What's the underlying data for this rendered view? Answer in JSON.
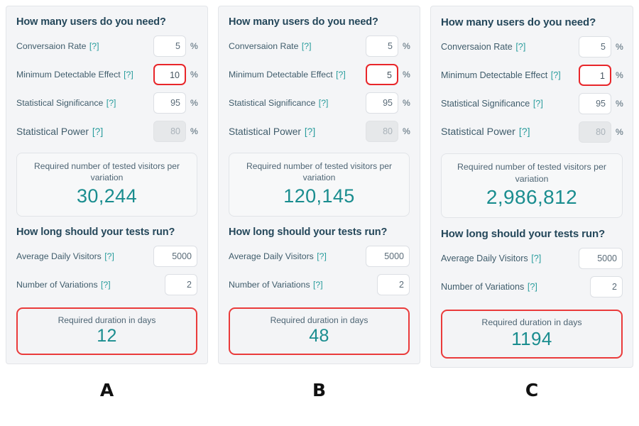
{
  "panels": [
    {
      "caption": "A",
      "users_heading": "How many users do you need?",
      "fields": [
        {
          "label": "Conversaion Rate",
          "help": "[?]",
          "value": "5",
          "unit": "%"
        },
        {
          "label": "Minimum Detectable Effect",
          "help": "[?]",
          "value": "10",
          "unit": "%"
        },
        {
          "label": "Statistical Significance",
          "help": "[?]",
          "value": "95",
          "unit": "%"
        },
        {
          "label": "Statistical Power",
          "help": "[?]",
          "value": "80",
          "unit": "%"
        }
      ],
      "visitors_caption": "Required number of tested visitors per variation",
      "visitors_value": "30,244",
      "duration_heading": "How long should your tests run?",
      "duration_fields": [
        {
          "label": "Average Daily Visitors",
          "help": "[?]",
          "value": "5000"
        },
        {
          "label": "Number of Variations",
          "help": "[?]",
          "value": "2"
        }
      ],
      "duration_caption": "Required duration in days",
      "duration_value": "12"
    },
    {
      "caption": "B",
      "users_heading": "How many users do you need?",
      "fields": [
        {
          "label": "Conversaion Rate",
          "help": "[?]",
          "value": "5",
          "unit": "%"
        },
        {
          "label": "Minimum Detectable Effect",
          "help": "[?]",
          "value": "5",
          "unit": "%"
        },
        {
          "label": "Statistical Significance",
          "help": "[?]",
          "value": "95",
          "unit": "%"
        },
        {
          "label": "Statistical Power",
          "help": "[?]",
          "value": "80",
          "unit": "%"
        }
      ],
      "visitors_caption": "Required number of tested visitors per variation",
      "visitors_value": "120,145",
      "duration_heading": "How long should your tests run?",
      "duration_fields": [
        {
          "label": "Average Daily Visitors",
          "help": "[?]",
          "value": "5000"
        },
        {
          "label": "Number of Variations",
          "help": "[?]",
          "value": "2"
        }
      ],
      "duration_caption": "Required duration in days",
      "duration_value": "48"
    },
    {
      "caption": "C",
      "users_heading": "How many users do you need?",
      "fields": [
        {
          "label": "Conversaion Rate",
          "help": "[?]",
          "value": "5",
          "unit": "%"
        },
        {
          "label": "Minimum Detectable Effect",
          "help": "[?]",
          "value": "1",
          "unit": "%"
        },
        {
          "label": "Statistical Significance",
          "help": "[?]",
          "value": "95",
          "unit": "%"
        },
        {
          "label": "Statistical Power",
          "help": "[?]",
          "value": "80",
          "unit": "%"
        }
      ],
      "visitors_caption": "Required number of tested visitors per variation",
      "visitors_value": "2,986,812",
      "duration_heading": "How long should your tests run?",
      "duration_fields": [
        {
          "label": "Average Daily Visitors",
          "help": "[?]",
          "value": "5000"
        },
        {
          "label": "Number of Variations",
          "help": "[?]",
          "value": "2"
        }
      ],
      "duration_caption": "Required duration in days",
      "duration_value": "1194"
    }
  ],
  "colors": {
    "teal_accent": "#1a8d8f",
    "highlight_red": "#ea3b3b",
    "heading_slate": "#24475a",
    "panel_bg": "#f4f5f7",
    "disabled_bg": "#e6e8ea"
  }
}
